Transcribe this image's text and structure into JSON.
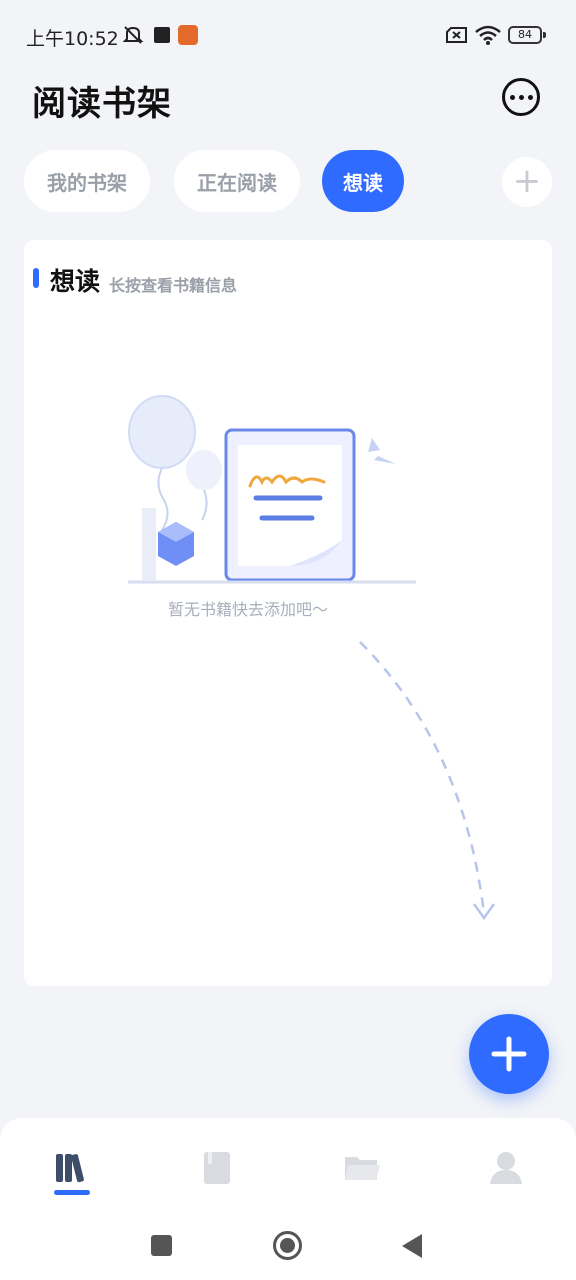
{
  "status_bar": {
    "time": "上午10:52",
    "battery": "84"
  },
  "header": {
    "title": "阅读书架"
  },
  "tabs": [
    {
      "label": "我的书架"
    },
    {
      "label": "正在阅读"
    },
    {
      "label": "想读"
    }
  ],
  "section": {
    "title": "想读",
    "hint": "长按查看书籍信息"
  },
  "empty_state": {
    "text": "暂无书籍快去添加吧～"
  },
  "colors": {
    "accent": "#2f6bff",
    "background": "#f2f4f7"
  },
  "bottom_nav": [
    {
      "icon": "bookshelf-icon"
    },
    {
      "icon": "book-icon"
    },
    {
      "icon": "folder-icon"
    },
    {
      "icon": "profile-icon"
    }
  ]
}
